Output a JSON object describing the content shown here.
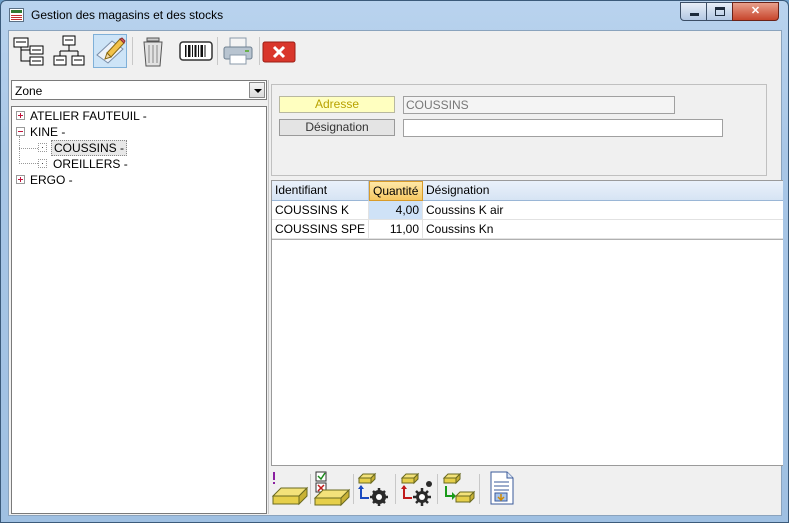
{
  "window": {
    "title": "Gestion des magasins et des stocks",
    "icon": "table-icon"
  },
  "toolbar": {
    "buttons": [
      {
        "icon": "tree-expand-icon"
      },
      {
        "icon": "hierarchy-icon"
      },
      {
        "icon": "edit-pencil-icon",
        "active": true
      },
      {
        "icon": "trash-can-icon"
      },
      {
        "icon": "barcode-icon"
      },
      {
        "icon": "printer-icon"
      },
      {
        "icon": "close-red-icon"
      }
    ]
  },
  "left": {
    "combo_value": "Zone",
    "tree": [
      {
        "label": "ATELIER FAUTEUIL -",
        "level": 0,
        "expander": "plus"
      },
      {
        "label": "KINE -",
        "level": 0,
        "expander": "minus"
      },
      {
        "label": "COUSSINS -",
        "level": 1,
        "expander": "leaf",
        "selected": true
      },
      {
        "label": "OREILLERS -",
        "level": 1,
        "expander": "leaf"
      },
      {
        "label": "ERGO -",
        "level": 0,
        "expander": "plus"
      }
    ]
  },
  "detail": {
    "adresse_label": "Adresse",
    "adresse_value": "COUSSINS",
    "designation_label": "Désignation",
    "designation_value": ""
  },
  "grid": {
    "columns": [
      "Identifiant",
      "Quantité",
      "Désignation"
    ],
    "sorted_column": "Quantité",
    "rows": [
      {
        "identifiant": "COUSSINS K",
        "quantite": "4,00",
        "designation": "Coussins K air"
      },
      {
        "identifiant": "COUSSINS SPE",
        "quantite": "11,00",
        "designation": "Coussins Kn"
      }
    ]
  },
  "bottom_toolbar": {
    "buttons": [
      {
        "icon": "new-stock-icon"
      },
      {
        "icon": "validate-stock-icon"
      },
      {
        "icon": "stock-in-settings-icon"
      },
      {
        "icon": "stock-out-settings-icon"
      },
      {
        "icon": "stock-transfer-icon"
      },
      {
        "icon": "report-document-icon"
      }
    ]
  },
  "colors": {
    "accent": "#cde4f7",
    "adresse_bg": "#ffffc0",
    "sorted_header": "#f6c862",
    "close_red": "#d9362b"
  }
}
